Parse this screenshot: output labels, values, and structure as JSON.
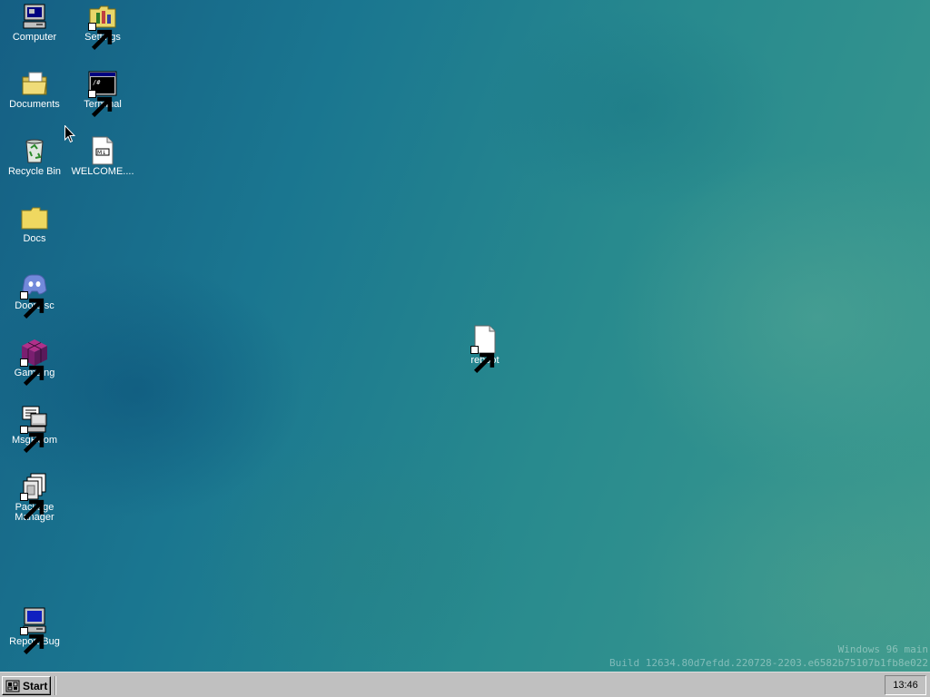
{
  "desktop": {
    "icons": [
      {
        "label": "Computer"
      },
      {
        "label": "Settings"
      },
      {
        "label": "Documents"
      },
      {
        "label": "Terminal"
      },
      {
        "label": "Recycle Bin"
      },
      {
        "label": "WELCOME...."
      },
      {
        "label": "Docs"
      },
      {
        "label": "Doordisc"
      },
      {
        "label": "Gameing"
      },
      {
        "label": "MsgRoom"
      },
      {
        "label": "Package Manager"
      },
      {
        "label": "Report Bug"
      },
      {
        "label": "reboot"
      }
    ],
    "build_info": {
      "line1": "Windows 96 main",
      "line2": "Build 12634.80d7efdd.220728-2203.e6582b75107b1fb8e022"
    }
  },
  "taskbar": {
    "start_label": "Start",
    "clock": "13:46"
  },
  "colors": {
    "desktop_base": "#1a7690",
    "taskbar": "#c0c0c0",
    "icon_label": "#ffffff"
  }
}
